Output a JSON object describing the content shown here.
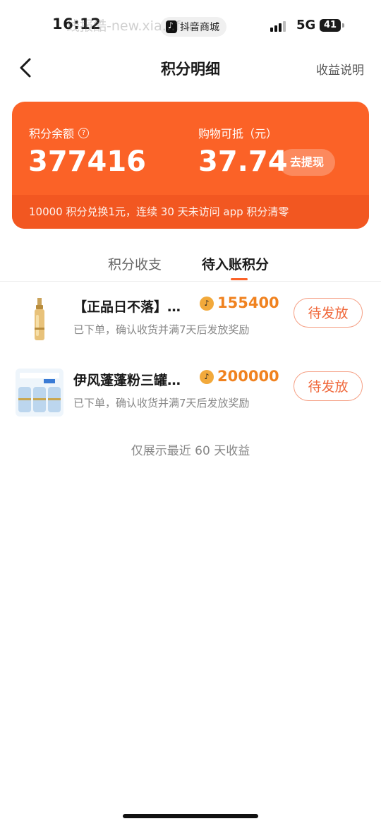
{
  "status_bar": {
    "time": "16:12",
    "app_name": "抖音商城",
    "network": "5G",
    "battery": "41",
    "watermark": "线报酷-new.xia…fun"
  },
  "nav": {
    "title": "积分明细",
    "right_link": "收益说明"
  },
  "summary_card": {
    "balance_label": "积分余额",
    "balance_value": "377416",
    "deduct_label": "购物可抵（元）",
    "deduct_value": "37.74",
    "withdraw_label": "去提现",
    "footer_note": "10000 积分兑换1元，连续 30 天未访问 app 积分清零",
    "colors": {
      "card": "#fb6227",
      "footer": "#f25721"
    }
  },
  "tabs": [
    {
      "label": "积分收支",
      "active": false
    },
    {
      "label": "待入账积分",
      "active": true
    }
  ],
  "items": [
    {
      "title": "【正品日不落】…",
      "points": "155400",
      "subtitle": "已下单，确认收货并满7天后发放奖励",
      "action": "待发放",
      "thumb_icon": "serum-bottle-icon"
    },
    {
      "title": "伊风蓬蓬粉三罐…",
      "points": "200000",
      "subtitle": "已下单，确认收货并满7天后发放奖励",
      "action": "待发放",
      "thumb_icon": "powder-jars-icon"
    }
  ],
  "footer_note": "仅展示最近 60 天收益",
  "accent_color": "#f0821f"
}
